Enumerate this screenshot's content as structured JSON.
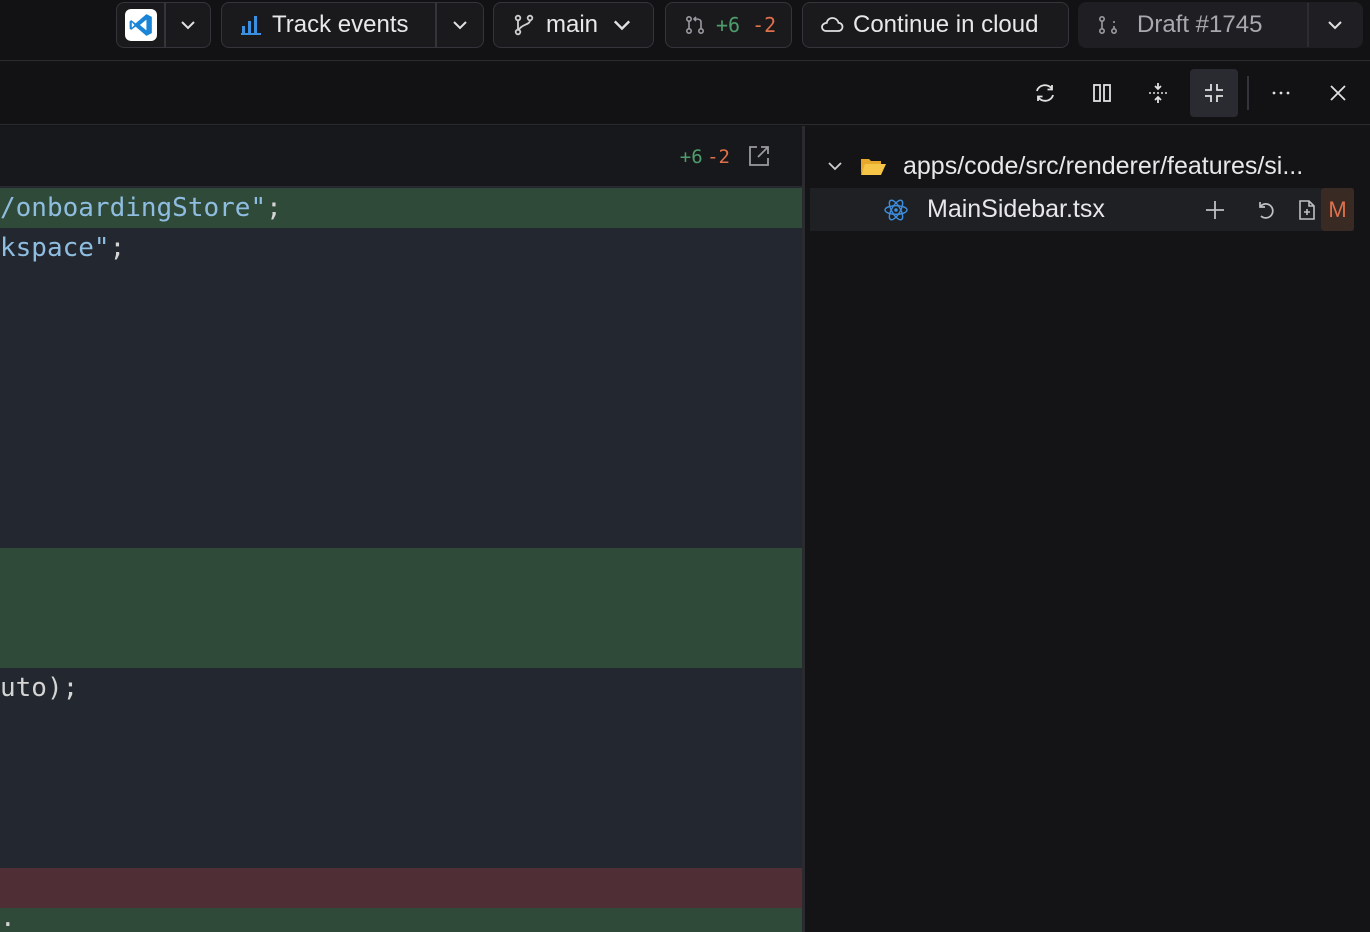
{
  "toolbar": {
    "editor_icon": "vscode-icon",
    "track_label": "Track events",
    "branch_label": "main",
    "diff_add": "+6",
    "diff_del": "-2",
    "cloud_label": "Continue in cloud",
    "draft_label": "Draft #1745"
  },
  "subbar": {
    "buttons": [
      "refresh-icon",
      "split-view-icon",
      "expand-icon",
      "collapse-icon",
      "more-icon",
      "close-icon"
    ]
  },
  "code": {
    "header_add": "+6",
    "header_del": "-2",
    "lines": [
      {
        "text_pre": "",
        "text_str": "/onboardingStore\"",
        "text_post": ";",
        "type": "added"
      },
      {
        "text_pre": "",
        "text_str": "kspace\"",
        "text_post": ";",
        "type": "context"
      },
      {
        "text": "uto);",
        "type": "context"
      },
      {
        "text": ".",
        "type": "added"
      }
    ]
  },
  "tree": {
    "folder_path": "apps/code/src/renderer/features/si...",
    "file_name": "MainSidebar.tsx",
    "file_status": "M"
  },
  "colors": {
    "added_bg": "#304a3a",
    "removed_bg": "#4f2f35",
    "add_text": "#4f9d6c",
    "del_text": "#e0704a"
  }
}
